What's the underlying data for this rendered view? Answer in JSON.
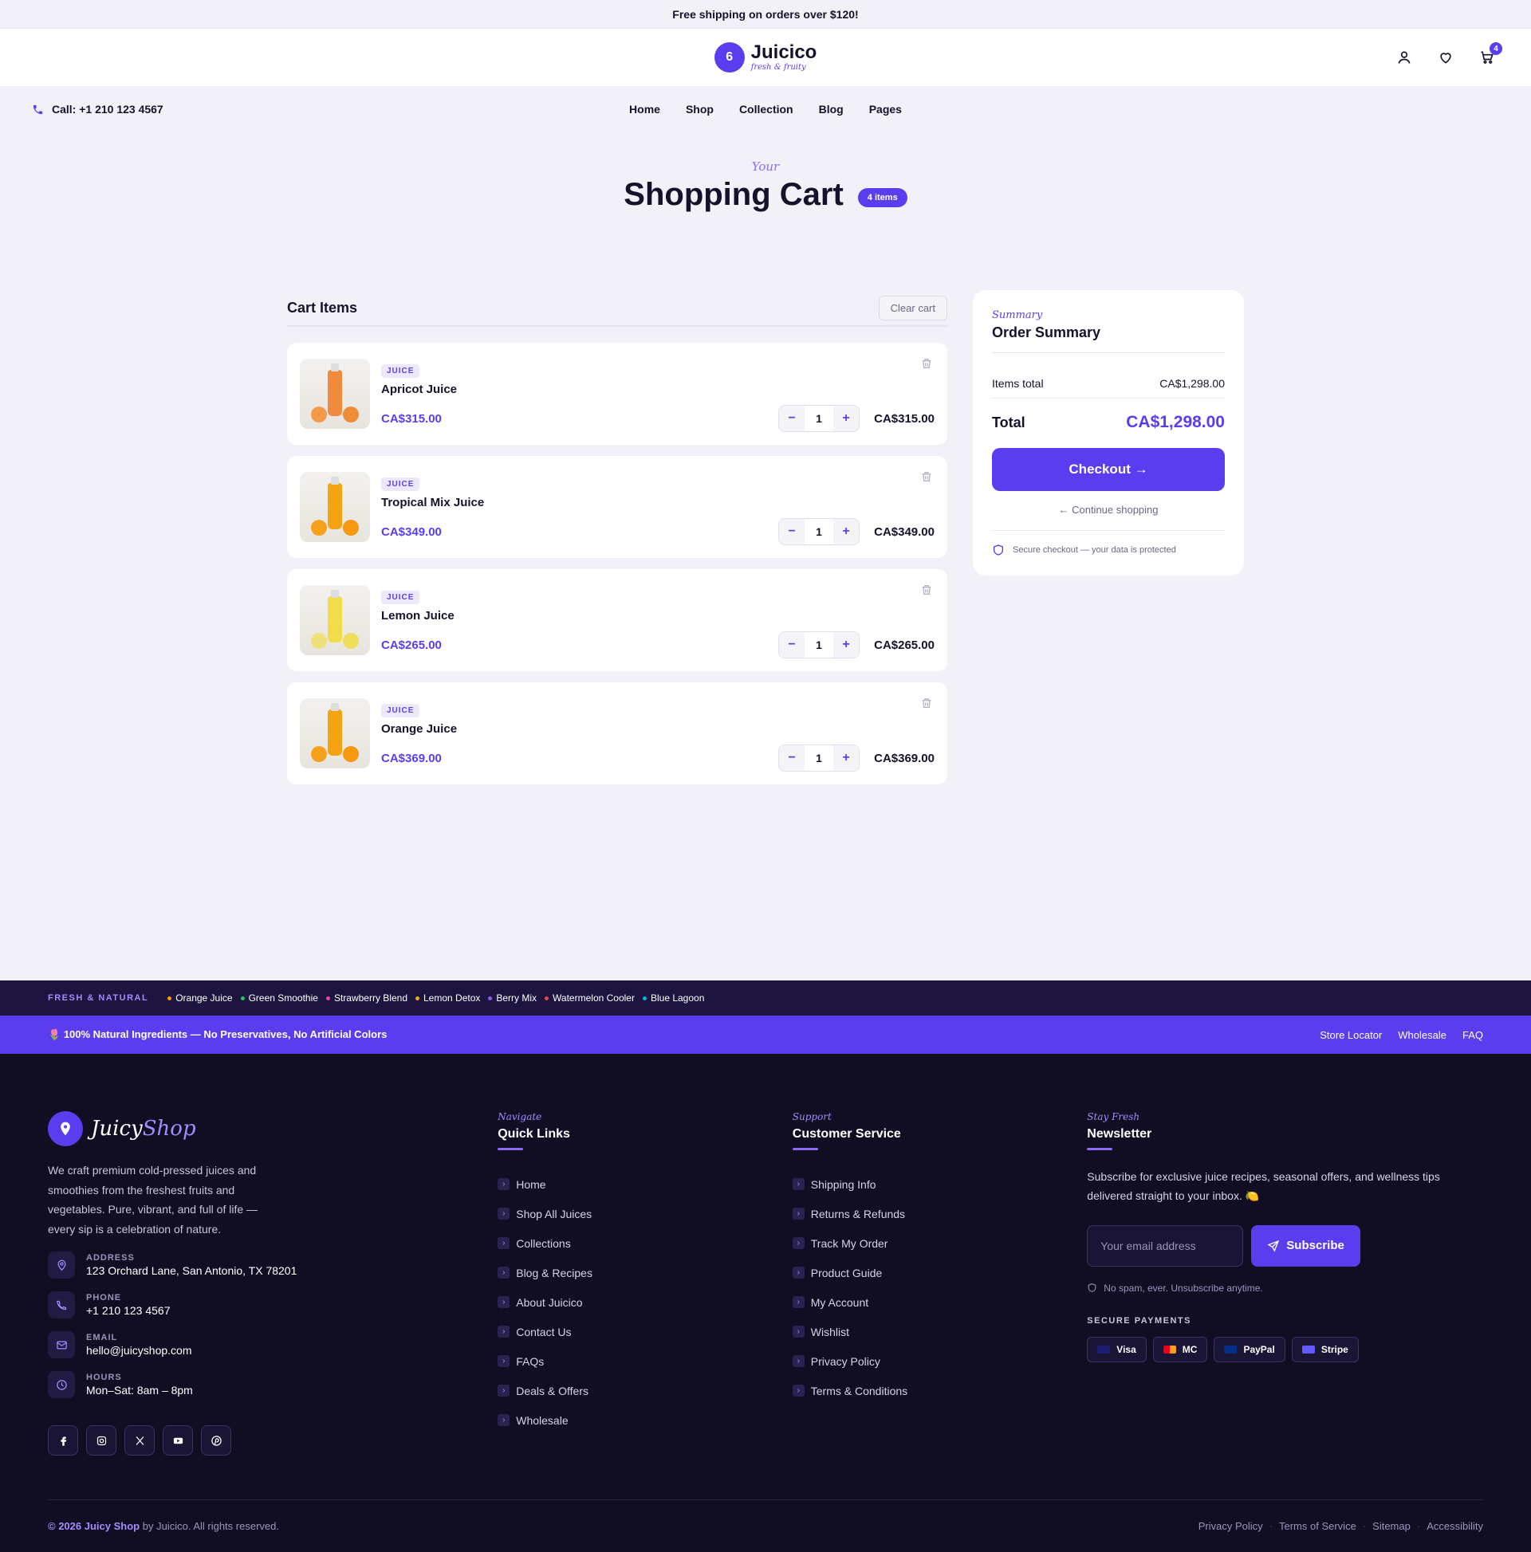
{
  "announcement": "Free shipping on orders over $120!",
  "brand": {
    "name": "Juicico",
    "tagline": "fresh & fruity",
    "mark": "6"
  },
  "header": {
    "cart_count": "4"
  },
  "topnav": {
    "call": "Call: +1 210 123 4567",
    "links": [
      "Home",
      "Shop",
      "Collection",
      "Blog",
      "Pages"
    ]
  },
  "page": {
    "eyebrow": "Your",
    "title": "Shopping Cart",
    "count_badge": "4 items"
  },
  "cart": {
    "heading": "Cart Items",
    "clear_label": "Clear cart",
    "items": [
      {
        "category": "JUICE",
        "name": "Apricot Juice",
        "price": "CA$315.00",
        "qty": "1",
        "line_total": "CA$315.00"
      },
      {
        "category": "JUICE",
        "name": "Tropical Mix Juice",
        "price": "CA$349.00",
        "qty": "1",
        "line_total": "CA$349.00"
      },
      {
        "category": "JUICE",
        "name": "Lemon Juice",
        "price": "CA$265.00",
        "qty": "1",
        "line_total": "CA$265.00"
      },
      {
        "category": "JUICE",
        "name": "Orange Juice",
        "price": "CA$369.00",
        "qty": "1",
        "line_total": "CA$369.00"
      }
    ]
  },
  "summary": {
    "eyebrow": "Summary",
    "title": "Order Summary",
    "items_total_label": "Items total",
    "items_total_value": "CA$1,298.00",
    "total_label": "Total",
    "total_value": "CA$1,298.00",
    "checkout_label": "Checkout →",
    "continue_label": "← Continue shopping",
    "secure_note": "Secure checkout — your data is protected"
  },
  "fresh_strip": {
    "label": "FRESH & NATURAL",
    "items": [
      {
        "name": "Orange Juice",
        "color": "#f59e0b"
      },
      {
        "name": "Green Smoothie",
        "color": "#22c55e"
      },
      {
        "name": "Strawberry Blend",
        "color": "#ec4899"
      },
      {
        "name": "Lemon Detox",
        "color": "#eab308"
      },
      {
        "name": "Berry Mix",
        "color": "#8b5cf6"
      },
      {
        "name": "Watermelon Cooler",
        "color": "#ef4444"
      },
      {
        "name": "Blue Lagoon",
        "color": "#06b6d4"
      }
    ]
  },
  "natural_bar": {
    "text": "100% Natural Ingredients — No Preservatives, No Artificial Colors",
    "links": [
      "Store Locator",
      "Wholesale",
      "FAQ"
    ]
  },
  "footer": {
    "brand_first": "Juicy",
    "brand_second": "Shop",
    "description": "We craft premium cold-pressed juices and smoothies from the freshest fruits and vegetables. Pure, vibrant, and full of life — every sip is a celebration of nature.",
    "contacts": [
      {
        "label": "ADDRESS",
        "value": "123 Orchard Lane, San Antonio, TX 78201",
        "icon": "location-icon"
      },
      {
        "label": "PHONE",
        "value": "+1 210 123 4567",
        "icon": "phone-icon"
      },
      {
        "label": "EMAIL",
        "value": "hello@juicyshop.com",
        "icon": "mail-icon"
      },
      {
        "label": "HOURS",
        "value": "Mon–Sat: 8am – 8pm",
        "icon": "clock-icon"
      }
    ],
    "quick_links": {
      "tag": "Navigate",
      "heading": "Quick Links",
      "links": [
        "Home",
        "Shop All Juices",
        "Collections",
        "Blog & Recipes",
        "About Juicico",
        "Contact Us",
        "FAQs",
        "Deals & Offers",
        "Wholesale"
      ]
    },
    "customer_service": {
      "tag": "Support",
      "heading": "Customer Service",
      "links": [
        "Shipping Info",
        "Returns & Refunds",
        "Track My Order",
        "Product Guide",
        "My Account",
        "Wishlist",
        "Privacy Policy",
        "Terms & Conditions"
      ]
    },
    "newsletter": {
      "tag": "Stay Fresh",
      "heading": "Newsletter",
      "text": "Subscribe for exclusive juice recipes, seasonal offers, and wellness tips delivered straight to your inbox. 🍋",
      "placeholder": "Your email address",
      "button": "Subscribe",
      "note": "No spam, ever. Unsubscribe anytime.",
      "payments_label": "SECURE PAYMENTS",
      "payments": [
        "Visa",
        "MC",
        "PayPal",
        "Stripe"
      ]
    },
    "copyright_year": "© 2026",
    "copyright_brand": "Juicy Shop",
    "copyright_rest": "by Juicico. All rights reserved.",
    "legal_links": [
      "Privacy Policy",
      "Terms of Service",
      "Sitemap",
      "Accessibility"
    ]
  }
}
